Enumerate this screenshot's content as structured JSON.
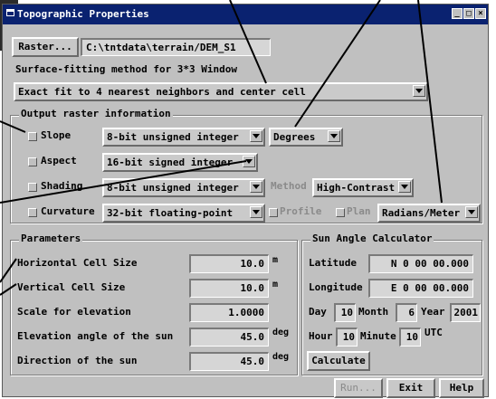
{
  "window": {
    "title": "Topographic Properties"
  },
  "raster": {
    "button_label": "Raster...",
    "path": "C:\\tntdata\\terrain/DEM_S1"
  },
  "fit": {
    "label": "Surface-fitting method for 3*3 Window",
    "selected": "Exact fit to 4 nearest neighbors and center cell"
  },
  "output": {
    "title": "Output raster information",
    "slope": {
      "label": "Slope",
      "type": "8-bit unsigned integer",
      "units": "Degrees"
    },
    "aspect": {
      "label": "Aspect",
      "type": "16-bit signed integer"
    },
    "shading": {
      "label": "Shading",
      "type": "8-bit unsigned integer",
      "method_label": "Method",
      "method": "High-Contrast"
    },
    "curvature": {
      "label": "Curvature",
      "type": "32-bit floating-point",
      "profile_label": "Profile",
      "plan_label": "Plan",
      "units": "Radians/Meter"
    }
  },
  "params": {
    "title": "Parameters",
    "rows": [
      {
        "label": "Horizontal Cell Size",
        "value": "10.0",
        "unit": "m"
      },
      {
        "label": "Vertical Cell Size",
        "value": "10.0",
        "unit": "m"
      },
      {
        "label": "Scale for elevation",
        "value": "1.0000",
        "unit": ""
      },
      {
        "label": "Elevation angle of the sun",
        "value": "45.0",
        "unit": "deg"
      },
      {
        "label": "Direction of the sun",
        "value": "45.0",
        "unit": "deg"
      }
    ]
  },
  "sun": {
    "title": "Sun Angle Calculator",
    "latitude_label": "Latitude",
    "latitude": "N 0 00 00.000",
    "longitude_label": "Longitude",
    "longitude": "E 0 00 00.000",
    "day_label": "Day",
    "day": "10",
    "month_label": "Month",
    "month": "6",
    "year_label": "Year",
    "year": "2001",
    "hour_label": "Hour",
    "hour": "10",
    "minute_label": "Minute",
    "minute": "10",
    "tz": "UTC",
    "calculate_label": "Calculate"
  },
  "footer": {
    "run_label": "Run...",
    "exit_label": "Exit",
    "help_label": "Help"
  }
}
